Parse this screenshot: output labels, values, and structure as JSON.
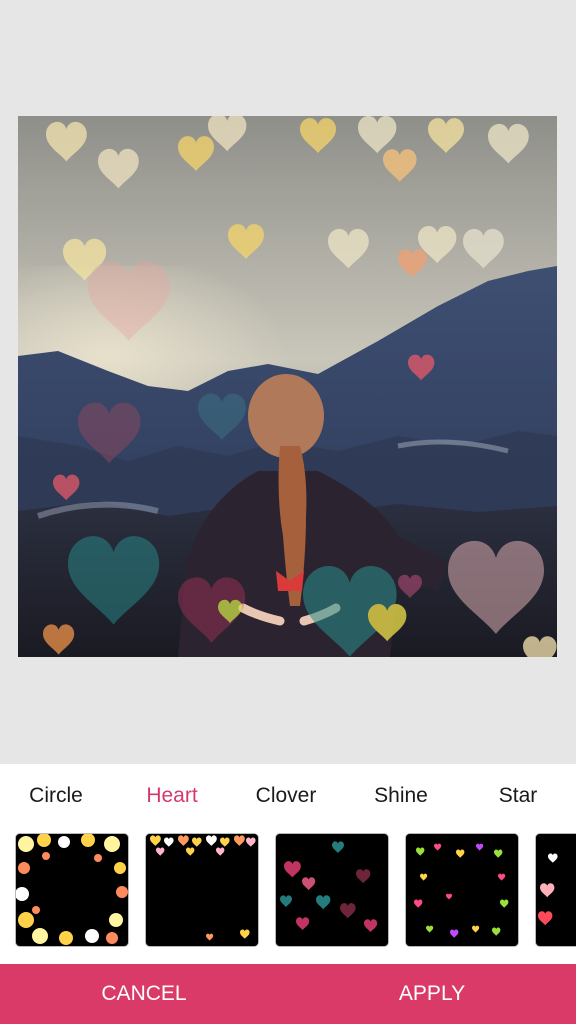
{
  "filter_tabs": [
    {
      "label": "Circle",
      "active": false
    },
    {
      "label": "Heart",
      "active": true
    },
    {
      "label": "Clover",
      "active": false
    },
    {
      "label": "Shine",
      "active": false
    },
    {
      "label": "Star",
      "active": false
    }
  ],
  "thumbnails": [
    {
      "name": "circle-bokeh",
      "palette": [
        "#fff4a0",
        "#ffd24a",
        "#ff8a5c",
        "#ffffff"
      ]
    },
    {
      "name": "heart-bokeh",
      "palette": [
        "#ffd24a",
        "#ff9a5c",
        "#ffffff",
        "#ffb6c8"
      ]
    },
    {
      "name": "clover-bokeh",
      "palette": [
        "#d63a6c",
        "#e05a7e",
        "#2a8a8a",
        "#7a2a40"
      ]
    },
    {
      "name": "shine-bokeh",
      "palette": [
        "#9adf3a",
        "#ff4a8a",
        "#ffd24a",
        "#c04aff"
      ]
    },
    {
      "name": "star-bokeh",
      "palette": [
        "#ff4a5a",
        "#ffb0b8",
        "#ffffff"
      ]
    }
  ],
  "actions": {
    "cancel": "CANCEL",
    "apply": "APPLY"
  },
  "colors": {
    "accent": "#d63a6c",
    "action_bar": "#d93a67",
    "background": "#e6e6e6"
  }
}
